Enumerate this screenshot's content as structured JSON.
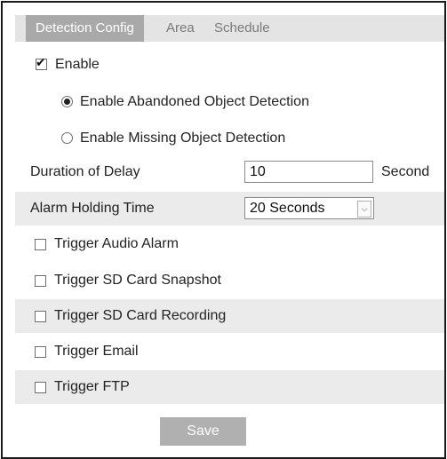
{
  "tabs": [
    {
      "label": "Detection Config",
      "active": true
    },
    {
      "label": "Area",
      "active": false
    },
    {
      "label": "Schedule",
      "active": false
    }
  ],
  "enable": {
    "label": "Enable",
    "checked": true
  },
  "detection_mode": {
    "options": [
      {
        "label": "Enable Abandoned Object Detection",
        "selected": true
      },
      {
        "label": "Enable Missing Object Detection",
        "selected": false
      }
    ]
  },
  "duration_of_delay": {
    "label": "Duration of Delay",
    "value": "10",
    "unit": "Second"
  },
  "alarm_holding_time": {
    "label": "Alarm Holding Time",
    "value": "20 Seconds"
  },
  "triggers": [
    {
      "label": "Trigger Audio Alarm",
      "checked": false
    },
    {
      "label": "Trigger SD Card Snapshot",
      "checked": false
    },
    {
      "label": "Trigger SD Card Recording",
      "checked": false
    },
    {
      "label": "Trigger Email",
      "checked": false
    },
    {
      "label": "Trigger FTP",
      "checked": false
    }
  ],
  "save_label": "Save",
  "colors": {
    "tab_active_bg": "#a9a9a9",
    "tab_bar_bg": "#e4e4e4",
    "row_shade": "#ebebeb",
    "button_bg": "#b0b0b0"
  }
}
